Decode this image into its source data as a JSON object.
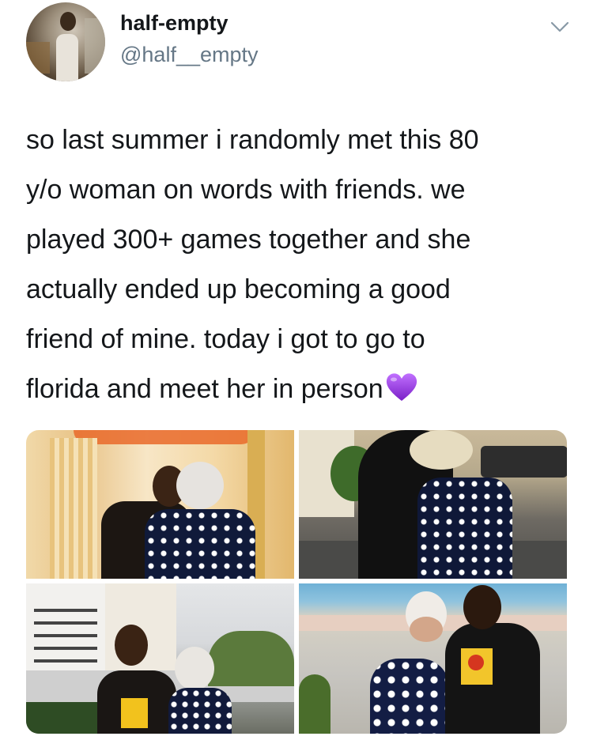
{
  "tweet": {
    "display_name": "half-empty",
    "handle": "@half__empty",
    "text_lines": [
      "so last summer i randomly met this 80",
      "y/o woman on words with friends. we",
      "played 300+ games together and she",
      "actually ended up becoming a good",
      "friend of mine. today i got to go to",
      "florida and meet her in person"
    ],
    "emoji": "purple-heart-icon",
    "photos": [
      "photo-hug-lobby",
      "photo-hug-outdoors",
      "photo-parking-lot",
      "photo-beach"
    ]
  },
  "colors": {
    "text": "#14171a",
    "handle": "#657786",
    "heart": "#9b3bd9"
  }
}
